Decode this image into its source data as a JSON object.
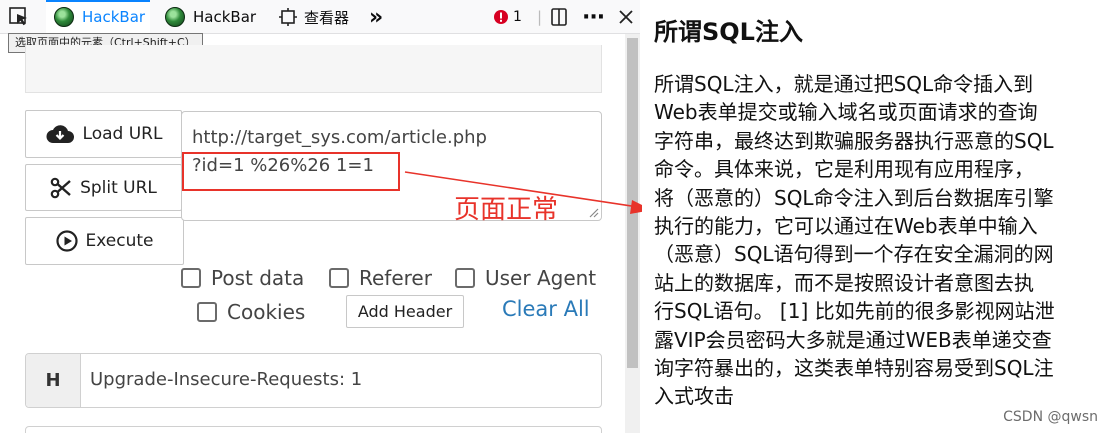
{
  "toolbar": {
    "tab1_label": "HackBar",
    "tab2_label": "HackBar",
    "inspector_label": "查看器",
    "error_count": "1"
  },
  "tooltip": "选取页面中的元素（Ctrl+Shift+C）",
  "buttons": {
    "load_url": "Load URL",
    "split_url": "Split URL",
    "execute": "Execute",
    "add_header": "Add Header",
    "clear_all": "Clear All"
  },
  "url": {
    "line1": "http://target_sys.com/article.php",
    "line2": "?id=1 %26%26 1=1"
  },
  "annotation": "页面正常",
  "options": {
    "post_data": "Post data",
    "referer": "Referer",
    "user_agent": "User Agent",
    "cookies": "Cookies"
  },
  "header_row": {
    "key": "H",
    "value": "Upgrade-Insecure-Requests: 1"
  },
  "article": {
    "title": "所谓SQL注入",
    "lines": [
      "所谓SQL注入，就是通过把SQL命令插入到",
      "Web表单提交或输入域名或页面请求的查询",
      "字符串，最终达到欺骗服务器执行恶意的SQL",
      "命令。具体来说，它是利用现有应用程序，",
      "将（恶意的）SQL命令注入到后台数据库引擎",
      "执行的能力，它可以通过在Web表单中输入",
      "（恶意）SQL语句得到一个存在安全漏洞的网",
      "站上的数据库，而不是按照设计者意图去执",
      "行SQL语句。 [1] 比如先前的很多影视网站泄",
      "露VIP会员密码大多就是通过WEB表单递交查",
      "询字符暴出的，这类表单特别容易受到SQL注",
      "入式攻击"
    ]
  },
  "watermark": "CSDN @qwsn",
  "colors": {
    "annotation_red": "#e8332a",
    "link_blue": "#2a7ab8",
    "error_red": "#d70022"
  }
}
